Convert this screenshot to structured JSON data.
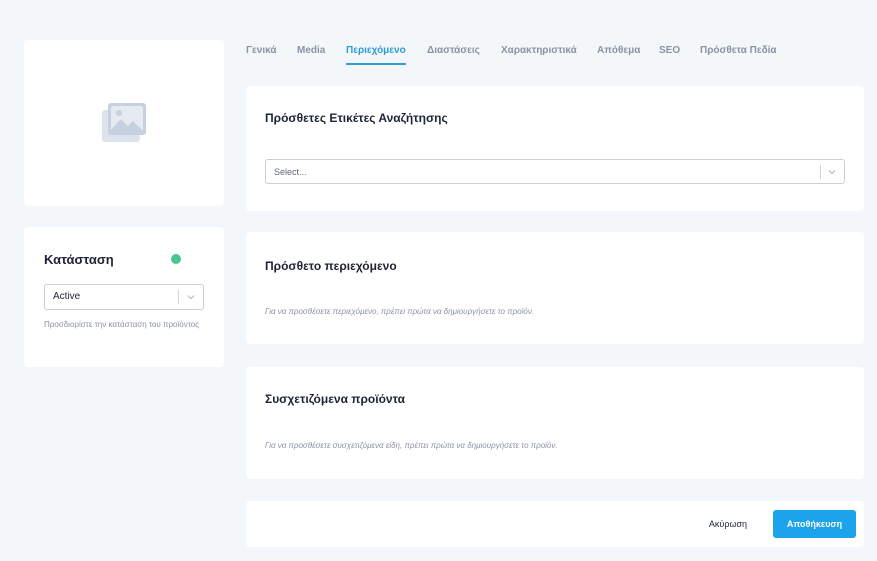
{
  "image_panel": {
    "icon": "image-placeholder-icon"
  },
  "status": {
    "title": "Κατάσταση",
    "indicator_color": "#48c78e",
    "selected": "Active",
    "help": "Προσδιορίστε την κατάσταση του προϊόντος"
  },
  "tabs": [
    {
      "label": "Γενικά"
    },
    {
      "label": "Media"
    },
    {
      "label": "Περιεχόμενο",
      "active": true
    },
    {
      "label": "Διαστάσεις"
    },
    {
      "label": "Χαρακτηριστικά"
    },
    {
      "label": "Απόθεμα"
    },
    {
      "label": "SEO"
    },
    {
      "label": "Πρόσθετα Πεδία"
    }
  ],
  "tags_section": {
    "title": "Πρόσθετες Ετικέτες Αναζήτησης",
    "placeholder": "Select..."
  },
  "extra_content": {
    "title": "Πρόσθετο περιεχόμενο",
    "note": "Για να προσθέσετε περιεχόμενο, πρέπει πρώτα να δημιουργήσετε το προϊόν."
  },
  "related_products": {
    "title": "Συσχετιζόμενα προϊόντα",
    "note": "Για να προσθέσετε συσχετιζόμενα είδη, πρέπει πρώτα να δημιουργήσετε το προϊόν."
  },
  "footer": {
    "cancel_label": "Ακύρωση",
    "save_label": "Αποθήκευση"
  },
  "colors": {
    "accent": "#2e9bd6",
    "primary_button": "#1ba3ec",
    "background": "#f4f7fa"
  }
}
